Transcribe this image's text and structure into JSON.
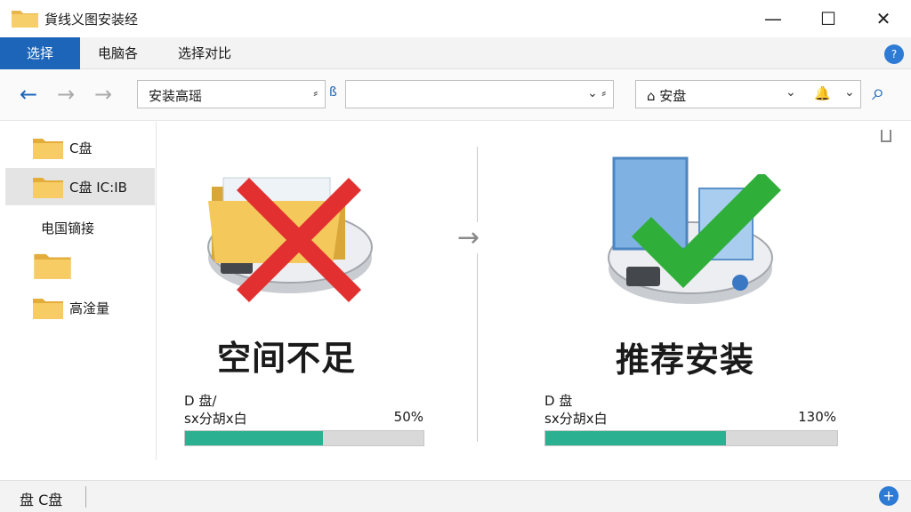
{
  "window": {
    "title": "貨线义图安装经",
    "minimize_glyph": "—",
    "maximize_glyph": "☐",
    "close_glyph": "✕"
  },
  "ribbon": {
    "tabs": [
      {
        "label": "选择",
        "active": true
      },
      {
        "label": "电脑各",
        "active": false
      },
      {
        "label": "选择对比",
        "active": false
      }
    ],
    "help_glyph": "?"
  },
  "address": {
    "back_glyph": "←",
    "forward_glyph": "→",
    "up_glyph": "→",
    "path_text": "安装高瑶",
    "path_caret": "⸗",
    "middle_marker": "ß",
    "middle_value": "",
    "middle_caret": "⌄ ⸗",
    "search_text": "⌂ 安盘",
    "search_caret": "⌄",
    "bell_glyph": "🔔",
    "bell_caret": "⌄",
    "search_icon_glyph": "⌕"
  },
  "sidebar": {
    "items": [
      {
        "label": "C盘",
        "has_folder": true,
        "selected": false
      },
      {
        "label": "C盘 IC:IB",
        "has_folder": true,
        "selected": true
      },
      {
        "label": "电国镝接",
        "has_folder": false,
        "selected": false
      },
      {
        "label": "",
        "has_folder": true,
        "selected": false
      },
      {
        "label": "高淦量",
        "has_folder": true,
        "selected": false
      }
    ]
  },
  "comparison": {
    "arrow_glyph": "→",
    "left": {
      "status_icon": "x-mark-icon",
      "heading": "空间不足",
      "drive": "D 盘/",
      "sub": "sx分胡x白",
      "percent_text": "50%",
      "fill_fraction": 0.58,
      "color": "#e02828"
    },
    "right": {
      "status_icon": "check-mark-icon",
      "heading": "推荐安装",
      "drive": "D 盘",
      "sub": "sx分胡x白",
      "percent_text": "130%",
      "fill_fraction": 0.62,
      "color": "#2fae3a"
    }
  },
  "statusbar": {
    "label": "盘 C盘",
    "plus_glyph": "+"
  },
  "colors": {
    "accent": "#1c65b8",
    "progress": "#2bb091"
  }
}
